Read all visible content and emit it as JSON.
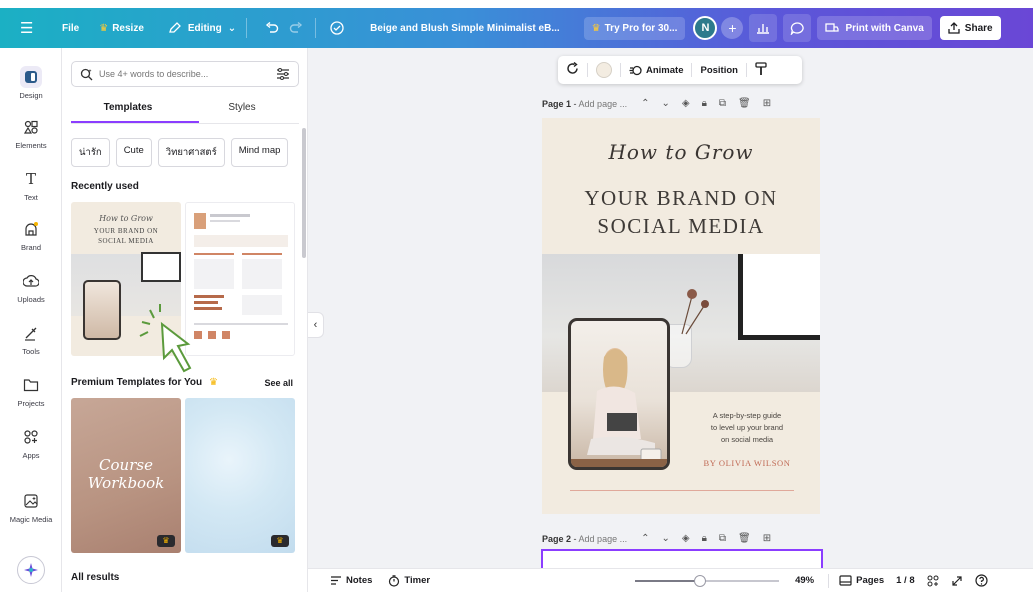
{
  "topbar": {
    "menu_icon": "hamburger-menu-icon",
    "file_label": "File",
    "resize_label": "Resize",
    "editing_label": "Editing",
    "doc_title": "Beige and Blush Simple Minimalist eB...",
    "try_pro_label": "Try Pro for 30...",
    "avatar_initial": "N",
    "plus_label": "+",
    "print_label": "Print with Canva",
    "share_label": "Share",
    "gradient_colors": [
      "#1bb0c4",
      "#3a8fd8",
      "#5b57d9",
      "#6a47d6"
    ]
  },
  "rail": {
    "items": [
      {
        "label": "Design",
        "icon": "design-icon"
      },
      {
        "label": "Elements",
        "icon": "elements-icon"
      },
      {
        "label": "Text",
        "icon": "text-icon"
      },
      {
        "label": "Brand",
        "icon": "brand-icon"
      },
      {
        "label": "Uploads",
        "icon": "uploads-icon"
      },
      {
        "label": "Tools",
        "icon": "tools-icon"
      },
      {
        "label": "Projects",
        "icon": "projects-icon"
      },
      {
        "label": "Apps",
        "icon": "apps-icon"
      },
      {
        "label": "Magic Media",
        "icon": "magic-media-icon"
      }
    ]
  },
  "panel": {
    "search_placeholder": "Use 4+ words to describe...",
    "tabs": [
      "Templates",
      "Styles"
    ],
    "chips": [
      "น่ารัก",
      "Cute",
      "วิทยาศาสตร์",
      "Mind map"
    ],
    "recently_used_title": "Recently used",
    "premium_title": "Premium Templates for You",
    "see_all_label": "See all",
    "all_results_title": "All results",
    "thumb_recent_1": {
      "script": "How to Grow",
      "title_lines": [
        "YOUR BRAND ON",
        "SOCIAL MEDIA"
      ]
    },
    "thumb_premium_1": {
      "lines": [
        "Course",
        "Workbook"
      ]
    }
  },
  "floating_toolbar": {
    "animate_label": "Animate",
    "position_label": "Position"
  },
  "pages": {
    "page1_label": "Page 1",
    "page1_title_placeholder": "Add page ...",
    "page2_label": "Page 2",
    "page2_title_placeholder": "Add page ..."
  },
  "design": {
    "script_title": "How to Grow",
    "big_title_line1": "YOUR BRAND ON",
    "big_title_line2": "SOCIAL MEDIA",
    "desc_lines": [
      "A step-by-step guide",
      "to level up your brand",
      "on social media"
    ],
    "byline": "BY OLIVIA WILSON",
    "background_color": "#f2ebe0",
    "accent_color": "#c06a55"
  },
  "bottombar": {
    "notes_label": "Notes",
    "timer_label": "Timer",
    "zoom_fraction": 0.45,
    "zoom_value": "49%",
    "pages_label": "Pages",
    "page_count": "1 / 8"
  },
  "annotations": {
    "highlight_color": "#e53030",
    "cursor_color": "#5b9a3c"
  }
}
